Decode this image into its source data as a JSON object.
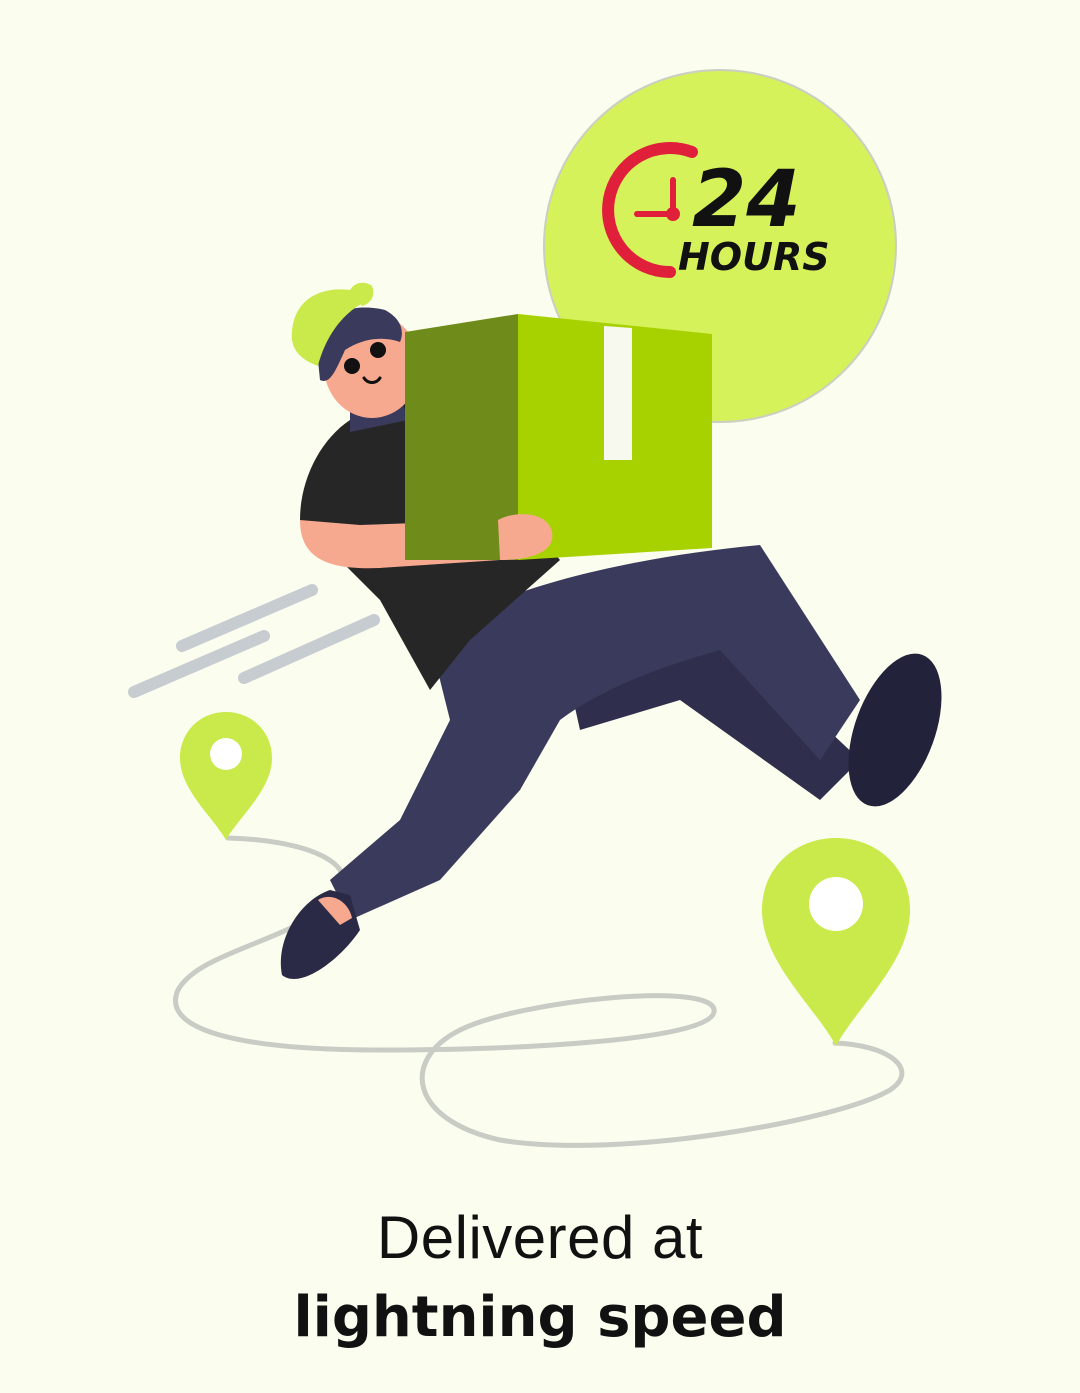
{
  "badge": {
    "number": "24",
    "unit": "HOURS",
    "icon": "clock-icon"
  },
  "caption": {
    "line1": "Delivered at",
    "line2": "lightning speed"
  },
  "icons": {
    "start_pin": "location-pin-icon",
    "end_pin": "location-pin-icon",
    "package": "package-box-icon"
  },
  "colors": {
    "background": "#fbfdef",
    "accent_lime": "#d5f25a",
    "pin_lime": "#c9ea4a",
    "box_light": "#a8d100",
    "box_dark": "#6f8b1a",
    "clock_red": "#e0203a",
    "pants_navy": "#3a3a5c",
    "shirt_black": "#262626",
    "skin": "#f7a98f",
    "text": "#111111"
  }
}
